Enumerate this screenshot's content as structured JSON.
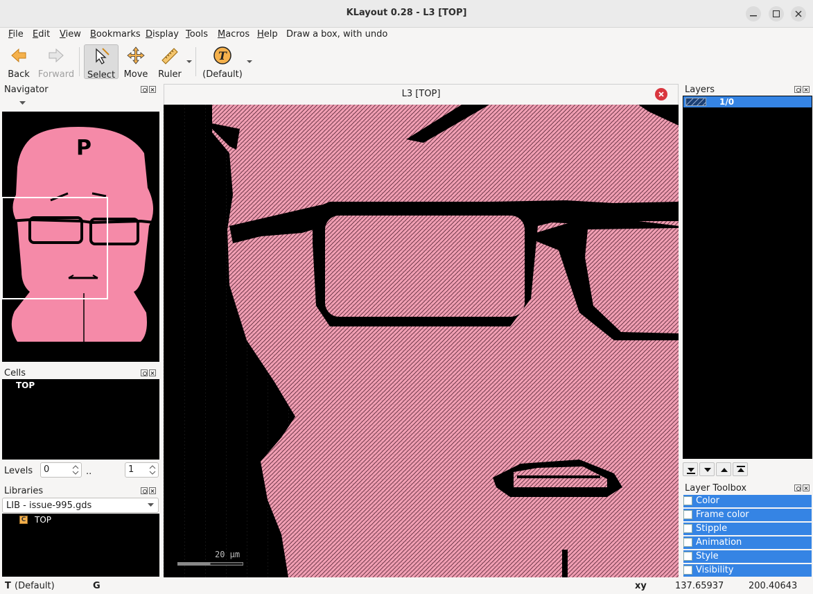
{
  "window": {
    "title": "KLayout 0.28 - L3 [TOP]"
  },
  "menu": {
    "items": [
      "File",
      "Edit",
      "View",
      "Bookmarks",
      "Display",
      "Tools",
      "Macros",
      "Help"
    ],
    "hint": "Draw a box, with undo"
  },
  "toolbar": {
    "back": "Back",
    "forward": "Forward",
    "select": "Select",
    "move": "Move",
    "ruler": "Ruler",
    "text_default": "(Default)"
  },
  "navigator": {
    "title": "Navigator"
  },
  "cells": {
    "title": "Cells",
    "items": [
      "TOP"
    ]
  },
  "levels": {
    "label": "Levels",
    "from": "0",
    "sep": "..",
    "to": "1"
  },
  "libraries": {
    "title": "Libraries",
    "selected": "LIB - issue-995.gds",
    "items": [
      "TOP"
    ]
  },
  "view": {
    "tab_title": "L3 [TOP]",
    "scale_label": "20 µm"
  },
  "layers": {
    "title": "Layers",
    "items": [
      "1/0"
    ]
  },
  "layer_toolbox": {
    "title": "Layer Toolbox",
    "items": [
      "Color",
      "Frame color",
      "Stipple",
      "Animation",
      "Style",
      "Visibility"
    ]
  },
  "status": {
    "text_mode": "T",
    "text_default": "(Default)",
    "grid": "G",
    "coord_label": "xy",
    "x": "137.65937",
    "y": "200.40643"
  },
  "colors": {
    "layer_fill": "#f2a0b4",
    "layer_dark": "#1b3f73",
    "selection": "#3584e4",
    "navigator_pink": "#f58aa8"
  }
}
